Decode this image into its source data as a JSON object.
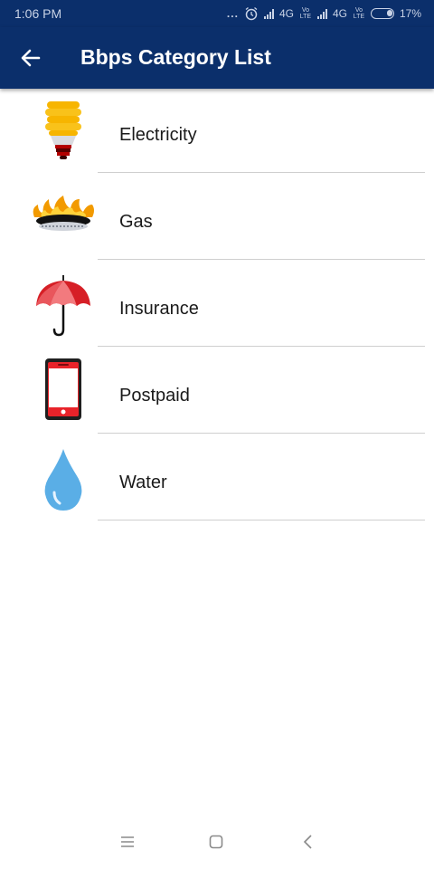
{
  "status_bar": {
    "time": "1:06 PM",
    "dots": "...",
    "net1": "4G",
    "net2": "4G",
    "volte1": "Vo LTE",
    "volte2": "Vo LTE",
    "battery": "17%"
  },
  "app_bar": {
    "title": "Bbps Category List"
  },
  "categories": [
    {
      "label": "Electricity",
      "icon": "light-bulb-icon"
    },
    {
      "label": "Gas",
      "icon": "gas-burner-icon"
    },
    {
      "label": "Insurance",
      "icon": "umbrella-icon"
    },
    {
      "label": "Postpaid",
      "icon": "mobile-phone-icon"
    },
    {
      "label": "Water",
      "icon": "water-drop-icon"
    }
  ],
  "colors": {
    "app_bar": "#0b2f6b",
    "divider": "#cfcfcf"
  }
}
